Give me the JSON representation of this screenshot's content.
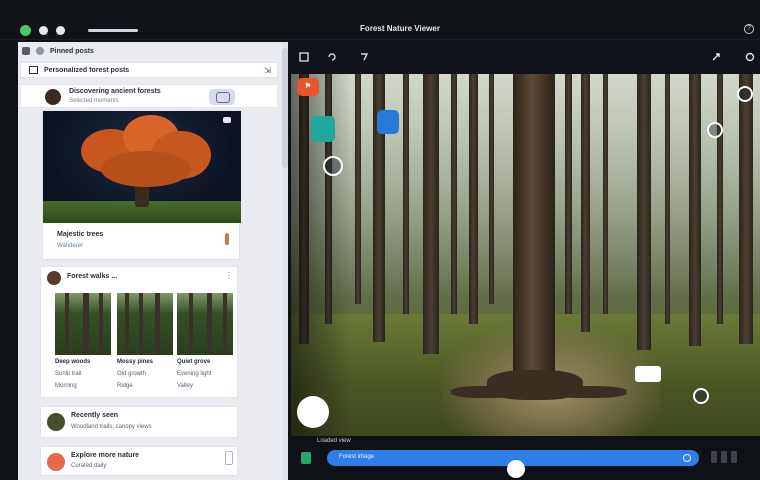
{
  "window": {
    "title": "Forest Nature Viewer",
    "help_icon": "help-circle-icon"
  },
  "left_panel": {
    "header": {
      "title": "Pinned posts"
    },
    "search": {
      "value": "Personalized forest posts"
    },
    "post": {
      "title": "Discovering ancient forests",
      "subtitle": "Selected moments"
    },
    "card1": {
      "caption": "Majestic trees",
      "subtitle": "Wanderer",
      "image": "autumn-tree-night"
    },
    "card2": {
      "author": "Forest walks ...",
      "items": [
        {
          "caption": "Deep woods",
          "line2": "Sunlit trail",
          "line3": "Morning"
        },
        {
          "caption": "Mossy pines",
          "line2": "Old growth",
          "line3": "Ridge"
        },
        {
          "caption": "Quiet grove",
          "line2": "Evening light",
          "line3": "Valley"
        }
      ]
    },
    "card3": {
      "title": "Recently seen",
      "subtitle": "Woodland trails, canopy views"
    },
    "card4": {
      "title": "Explore more nature",
      "subtitle": "Curated daily"
    }
  },
  "viewer": {
    "image": "forest-scene-tall-pines",
    "bottom_label": "Loaded view",
    "progress": {
      "text": "Forest image",
      "fraction": 0.5
    }
  },
  "colors": {
    "accent_blue": "#2f7ee8",
    "orange_badge": "#e8542c",
    "teal_badge": "#20a99a",
    "blue_badge": "#2979d6"
  }
}
